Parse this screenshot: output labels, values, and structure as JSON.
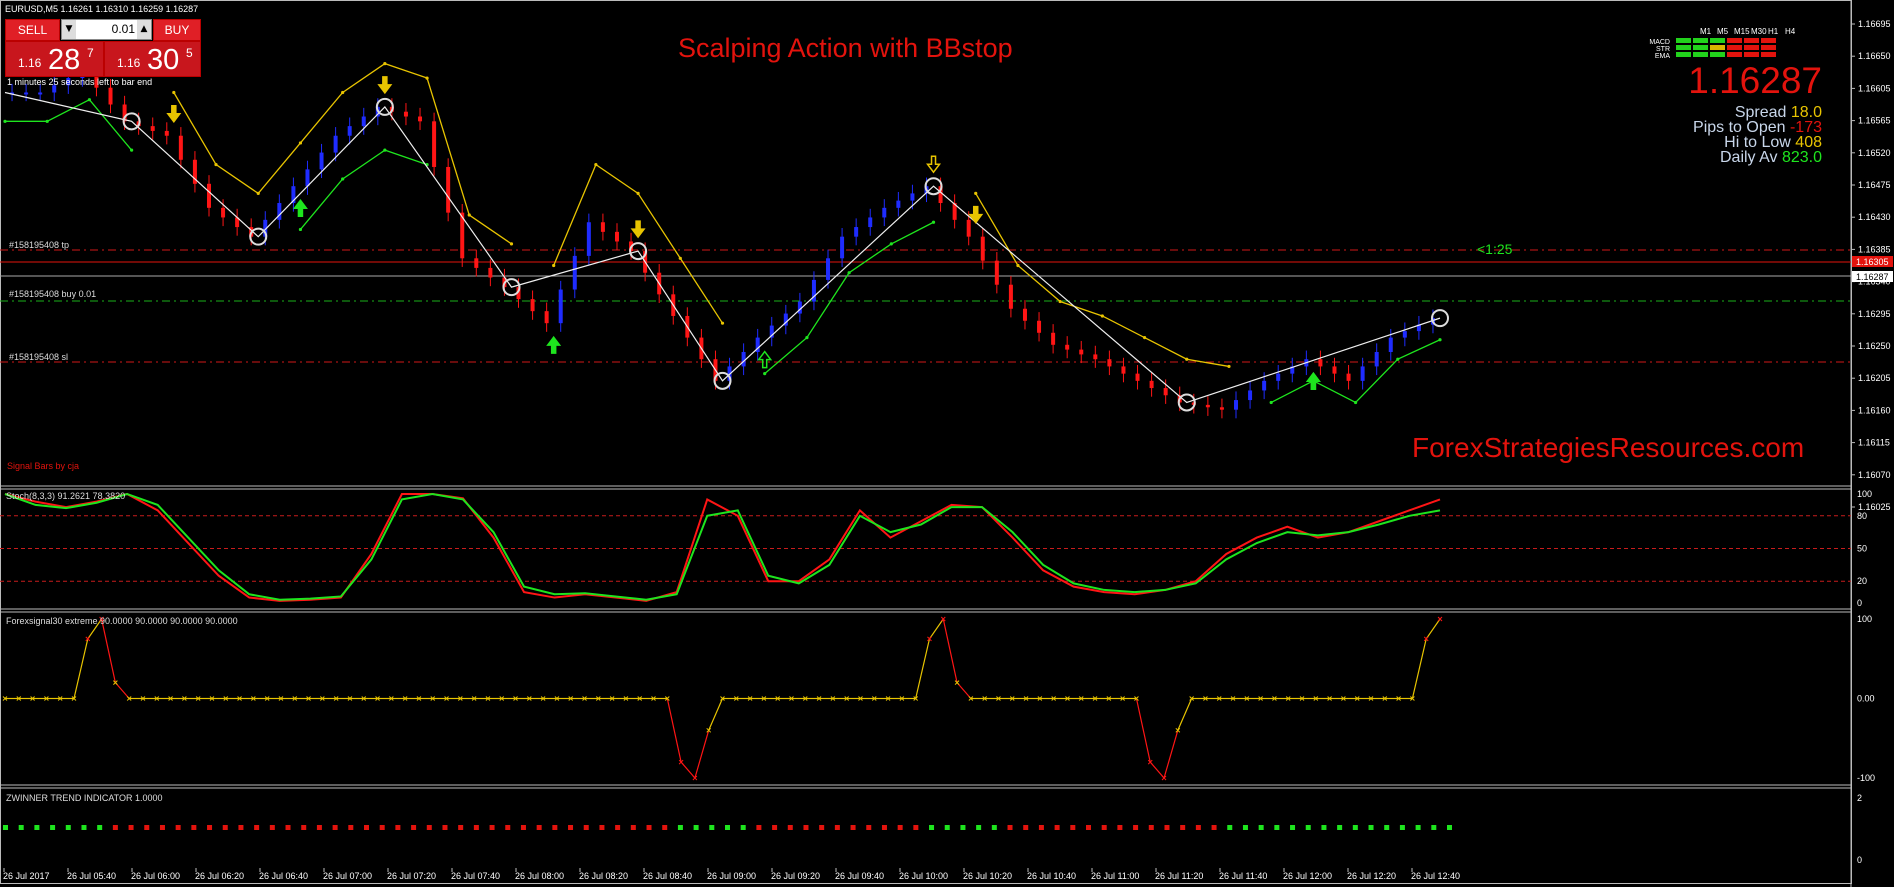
{
  "symbol_info": "EURUSD,M5  1.16261 1.16310 1.16259 1.16287",
  "chart_title": "Scalping Action with BBstop",
  "watermark": "ForexStrategiesResources.com",
  "trade_panel": {
    "sell_label": "SELL",
    "buy_label": "BUY",
    "lot": "0.01",
    "sell_prefix": "1.16",
    "sell_big": "28",
    "sell_sup": "7",
    "buy_prefix": "1.16",
    "buy_big": "30",
    "buy_sup": "5"
  },
  "timer_text": "1 minutes 25 seconds left to bar end",
  "signal_bars_label": "Signal Bars by cja",
  "order_lines": {
    "tp_label": "#158195408 tp",
    "buy_label": "#158195408 buy 0.01",
    "sl_label": "#158195408 sl",
    "ratio_label": "<1:25"
  },
  "dashboard": {
    "timeframes": [
      "M1",
      "M5",
      "M15",
      "M30",
      "H1",
      "H4"
    ],
    "rows": [
      "MACD",
      "STR",
      "EMA"
    ],
    "cells": [
      [
        "#22d21c",
        "#22d21c",
        "#22d21c",
        "#e3130d",
        "#e3130d",
        "#e3130d"
      ],
      [
        "#22d21c",
        "#22d21c",
        "#d9b600",
        "#e3130d",
        "#e3130d",
        "#e3130d"
      ],
      [
        "#22d21c",
        "#22d21c",
        "#22d21c",
        "#e3130d",
        "#e3130d",
        "#e3130d"
      ]
    ],
    "price": "1.16287",
    "spread_label": "Spread",
    "spread_value": "18.0",
    "pips_label": "Pips to Open",
    "pips_value": "-173",
    "hilo_label": "Hi to Low",
    "hilo_value": "408",
    "daily_label": "Daily Av",
    "daily_value": "823.0"
  },
  "price_axis": {
    "ticks": [
      "1.16695",
      "1.16650",
      "1.16605",
      "1.16565",
      "1.16520",
      "1.16475",
      "1.16430",
      "1.16385",
      "1.16340",
      "1.16295",
      "1.16250",
      "1.16205",
      "1.16160",
      "1.16115",
      "1.16070",
      "1.16025"
    ],
    "current_red": "1.16305",
    "current_white": "1.16287"
  },
  "stoch": {
    "label": "Stoch(8,3,3) 91.2621 78.3820",
    "ticks": [
      "100",
      "80",
      "50",
      "20",
      "0"
    ]
  },
  "forex_signal": {
    "label": "Forexsignal30 extreme 90.0000 90.0000 90.0000 90.0000",
    "ticks": [
      "100",
      "0.00",
      "-100"
    ]
  },
  "zwinner": {
    "label": "ZWINNER TREND INDICATOR 1.0000",
    "ticks": [
      "2",
      "0"
    ]
  },
  "time_axis": [
    "26 Jul 2017",
    "26 Jul 05:40",
    "26 Jul 06:00",
    "26 Jul 06:20",
    "26 Jul 06:40",
    "26 Jul 07:00",
    "26 Jul 07:20",
    "26 Jul 07:40",
    "26 Jul 08:00",
    "26 Jul 08:20",
    "26 Jul 08:40",
    "26 Jul 09:00",
    "26 Jul 09:20",
    "26 Jul 09:40",
    "26 Jul 10:00",
    "26 Jul 10:20",
    "26 Jul 10:40",
    "26 Jul 11:00",
    "26 Jul 11:20",
    "26 Jul 11:40",
    "26 Jul 12:00",
    "26 Jul 12:20",
    "26 Jul 12:40"
  ],
  "colors": {
    "bull": "#1f2cff",
    "bear": "#ff1515",
    "green": "#1ee51e",
    "yellow": "#e8c400",
    "red": "#e3130d"
  },
  "chart_data": [
    {
      "type": "line",
      "title": "EURUSD,M5",
      "series": [
        {
          "name": "EURUSD",
          "x_range": [
            "26 Jul 05:20",
            "26 Jul 12:45"
          ],
          "values": [
            1.166,
            1.166,
            1.1663,
            1.1656,
            1.1654,
            1.1644,
            1.164,
            1.1647,
            1.1654,
            1.1658,
            1.1656,
            1.1637,
            1.1633,
            1.1628,
            1.1642,
            1.1638,
            1.1629,
            1.162,
            1.1626,
            1.1631,
            1.164,
            1.1644,
            1.1647,
            1.164,
            1.163,
            1.1625,
            1.1623,
            1.162,
            1.1617,
            1.1616,
            1.162,
            1.1623,
            1.162,
            1.1626,
            1.16287
          ]
        }
      ]
    },
    {
      "type": "line",
      "title": "Stoch(8,3,3) 91.2621 78.3820",
      "ylim": [
        0,
        100
      ],
      "series": [
        {
          "name": "main",
          "values": [
            100,
            93,
            88,
            93,
            100,
            85,
            55,
            25,
            5,
            2,
            3,
            5,
            45,
            100,
            100,
            96,
            60,
            10,
            5,
            8,
            5,
            2,
            10,
            95,
            80,
            20,
            20,
            40,
            85,
            60,
            75,
            90,
            88,
            60,
            30,
            15,
            10,
            8,
            12,
            20,
            45,
            60,
            70,
            60,
            65,
            75,
            85,
            95
          ]
        },
        {
          "name": "signal",
          "values": [
            100,
            90,
            87,
            92,
            100,
            90,
            60,
            30,
            8,
            3,
            4,
            6,
            40,
            95,
            100,
            95,
            65,
            15,
            8,
            9,
            6,
            3,
            8,
            80,
            85,
            25,
            18,
            35,
            80,
            65,
            72,
            88,
            88,
            65,
            35,
            18,
            12,
            10,
            12,
            18,
            40,
            55,
            65,
            62,
            65,
            72,
            80,
            85
          ]
        }
      ]
    },
    {
      "type": "line",
      "title": "Forexsignal30 extreme 90.0000 90.0000 90.0000 90.0000",
      "ylim": [
        -100,
        100
      ],
      "series": [
        {
          "name": "extreme",
          "values": [
            0,
            0,
            0,
            0,
            0,
            0,
            75,
            100,
            20,
            0,
            0,
            0,
            0,
            0,
            0,
            0,
            0,
            0,
            0,
            0,
            0,
            0,
            0,
            0,
            0,
            0,
            0,
            0,
            0,
            0,
            0,
            0,
            0,
            0,
            0,
            0,
            0,
            0,
            0,
            0,
            0,
            0,
            0,
            0,
            0,
            0,
            0,
            0,
            0,
            -80,
            -100,
            -40,
            0,
            0,
            0,
            0,
            0,
            0,
            0,
            0,
            0,
            0,
            0,
            0,
            0,
            0,
            0,
            75,
            100,
            20,
            0,
            0,
            0,
            0,
            0,
            0,
            0,
            0,
            0,
            0,
            0,
            0,
            0,
            -80,
            -100,
            -40,
            0,
            0,
            0,
            0,
            0,
            0,
            0,
            0,
            0,
            0,
            0,
            0,
            0,
            0,
            0,
            0,
            0,
            75,
            100
          ]
        }
      ]
    }
  ]
}
